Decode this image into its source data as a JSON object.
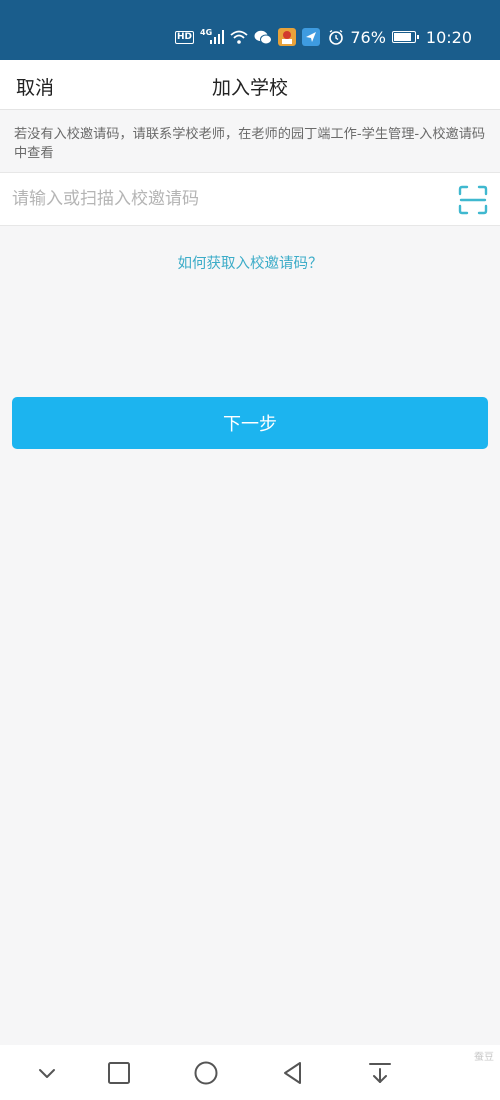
{
  "status_bar": {
    "hd_label": "HD",
    "network_label": "4G",
    "battery": "76%",
    "battery_level": 0.76,
    "time": "10:20",
    "icons": [
      "hd-icon",
      "signal-icon",
      "wifi-icon",
      "wechat-icon",
      "app-icon",
      "app-send-icon",
      "alarm-icon",
      "battery-icon"
    ]
  },
  "header": {
    "cancel_label": "取消",
    "title": "加入学校"
  },
  "hint": {
    "text": "若没有入校邀请码，请联系学校老师，在老师的园丁端工作-学生管理-入校邀请码中查看"
  },
  "invite_code": {
    "value": "",
    "placeholder": "请输入或扫描入校邀请码",
    "scan_icon": "scan-icon"
  },
  "help_link": {
    "label": "如何获取入校邀请码？"
  },
  "next_button": {
    "label": "下一步"
  },
  "nav_bar": {
    "buttons": [
      "chevron-down-icon",
      "square-icon",
      "circle-icon",
      "triangle-back-icon",
      "download-icon"
    ]
  },
  "watermark": "蚕豆",
  "colors": {
    "status_bar": "#1a5d8c",
    "primary_button": "#1cb4ef",
    "link": "#3cacc8",
    "scan_icon": "#3fb8cf"
  }
}
